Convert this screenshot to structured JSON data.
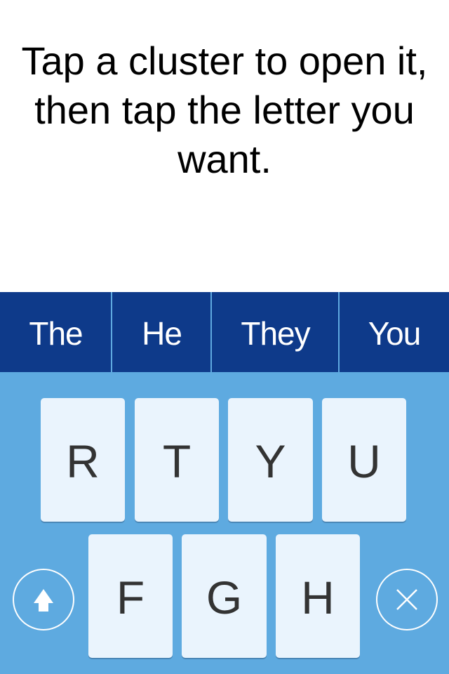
{
  "instruction": "Tap a cluster to open it, then tap the letter you want.",
  "suggestions": [
    "The",
    "He",
    "They",
    "You"
  ],
  "keys": {
    "row1": [
      "R",
      "T",
      "Y",
      "U"
    ],
    "row2": [
      "F",
      "G",
      "H"
    ]
  },
  "icons": {
    "shift": "shift-arrow-up-icon",
    "delete": "close-x-icon"
  },
  "colors": {
    "suggestion_bar": "#0e3a8a",
    "keyboard": "#5eaae0",
    "key": "#eaf4fd"
  }
}
